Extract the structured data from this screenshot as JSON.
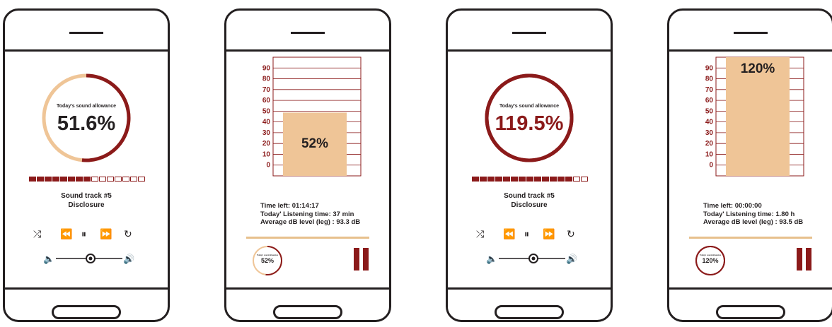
{
  "colors": {
    "accent": "#8b1a1a",
    "beige": "#efc597",
    "line": "#e7c08c",
    "outline": "#231f20"
  },
  "icons": {
    "shuffle": "⤮",
    "rewind": "⏪",
    "pause": "⏸",
    "forward": "⏩",
    "repeat": "↻",
    "volume_low": "🔈",
    "volume_high": "🔊"
  },
  "screens": [
    {
      "type": "allowance",
      "caption": "Today's sound allowance",
      "value": "51.6%",
      "fraction": 0.516,
      "value_color": "#231f20",
      "segments_filled": 8,
      "segments_total": 15,
      "track_title": "Sound track #5",
      "track_artist": "Disclosure"
    },
    {
      "type": "chart",
      "bar_label": "52%",
      "bar_value": 52,
      "stats": [
        "Time left: 01:14:17",
        "Today' Listening time: 37 min",
        "Average dB level (leg) : 93.3 dB"
      ],
      "mini_caption": "Today's sound allowance",
      "mini_value": "52%",
      "mini_fraction": 0.52
    },
    {
      "type": "allowance",
      "caption": "Today's sound allowance",
      "value": "119.5%",
      "fraction": 1.0,
      "value_color": "#8b1a1a",
      "segments_filled": 13,
      "segments_total": 15,
      "track_title": "Sound track #5",
      "track_artist": "Disclosure"
    },
    {
      "type": "chart",
      "bar_label": "120%",
      "bar_value": 100,
      "stats": [
        "Time left: 00:00:00",
        "Today' Listening time: 1.80 h",
        "Average dB level (leg) : 93.5 dB"
      ],
      "mini_caption": "Today's sound allowance",
      "mini_value": "120%",
      "mini_fraction": 1.0
    }
  ],
  "chart_data": {
    "type": "bar",
    "ticks": [
      "90",
      "80",
      "70",
      "60",
      "50",
      "40",
      "30",
      "20",
      "10",
      "0"
    ],
    "ylim": [
      0,
      100
    ]
  }
}
